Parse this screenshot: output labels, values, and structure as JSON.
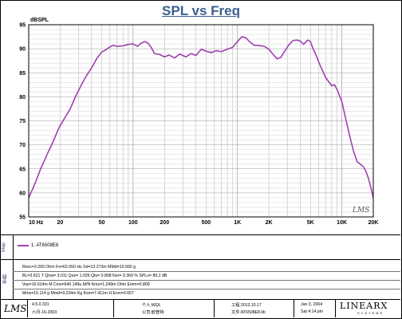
{
  "chart_data": {
    "type": "line",
    "title": "SPL vs Freq",
    "ylabel": "dBSPL",
    "xlabel": "",
    "x_scale": "log",
    "xlim": [
      10,
      20000
    ],
    "ylim": [
      55,
      95
    ],
    "grid": true,
    "y_ticks": [
      55,
      60,
      65,
      70,
      75,
      80,
      85,
      90,
      95
    ],
    "x_ticks": [
      {
        "value": 10,
        "label": "10 Hz"
      },
      {
        "value": 20,
        "label": "20"
      },
      {
        "value": 50,
        "label": "50"
      },
      {
        "value": 100,
        "label": "100"
      },
      {
        "value": 200,
        "label": "200"
      },
      {
        "value": 500,
        "label": "500"
      },
      {
        "value": 1000,
        "label": "1K"
      },
      {
        "value": 2000,
        "label": "2K"
      },
      {
        "value": 5000,
        "label": "5K"
      },
      {
        "value": 10000,
        "label": "10K"
      },
      {
        "value": 20000,
        "label": "20K"
      }
    ],
    "watermark": "LMS",
    "series": [
      {
        "name": "1: AT6508E8",
        "color": "#a040b0",
        "points": [
          [
            10,
            59
          ],
          [
            11,
            61
          ],
          [
            12,
            63
          ],
          [
            13,
            65
          ],
          [
            14,
            66.5
          ],
          [
            15,
            68
          ],
          [
            17,
            70.5
          ],
          [
            19,
            73
          ],
          [
            20,
            74
          ],
          [
            22,
            75.5
          ],
          [
            25,
            77.5
          ],
          [
            28,
            80
          ],
          [
            32,
            82.5
          ],
          [
            36,
            84.5
          ],
          [
            40,
            86
          ],
          [
            45,
            88
          ],
          [
            50,
            89.3
          ],
          [
            55,
            89.8
          ],
          [
            60,
            90.4
          ],
          [
            65,
            90.7
          ],
          [
            70,
            90.5
          ],
          [
            80,
            90.6
          ],
          [
            90,
            90.9
          ],
          [
            100,
            91
          ],
          [
            110,
            90.5
          ],
          [
            120,
            91.2
          ],
          [
            130,
            91.5
          ],
          [
            140,
            91.1
          ],
          [
            150,
            90.2
          ],
          [
            160,
            89
          ],
          [
            180,
            88.8
          ],
          [
            200,
            88.3
          ],
          [
            220,
            88.7
          ],
          [
            250,
            88.1
          ],
          [
            280,
            88.9
          ],
          [
            320,
            88.3
          ],
          [
            360,
            89
          ],
          [
            400,
            88.6
          ],
          [
            450,
            89.9
          ],
          [
            500,
            89.5
          ],
          [
            560,
            89.2
          ],
          [
            630,
            89.6
          ],
          [
            700,
            89.4
          ],
          [
            800,
            89.9
          ],
          [
            900,
            90.3
          ],
          [
            1000,
            91.5
          ],
          [
            1100,
            92.5
          ],
          [
            1200,
            92.3
          ],
          [
            1300,
            91.5
          ],
          [
            1450,
            90.7
          ],
          [
            1600,
            90.7
          ],
          [
            1800,
            90.5
          ],
          [
            2000,
            89.9
          ],
          [
            2200,
            88.8
          ],
          [
            2400,
            87.9
          ],
          [
            2600,
            88.2
          ],
          [
            2800,
            89.3
          ],
          [
            3100,
            90.8
          ],
          [
            3400,
            91.7
          ],
          [
            3700,
            91.8
          ],
          [
            4000,
            91.6
          ],
          [
            4300,
            90.9
          ],
          [
            4700,
            91.8
          ],
          [
            5000,
            91.5
          ],
          [
            5300,
            90
          ],
          [
            5700,
            88.5
          ],
          [
            6200,
            86.5
          ],
          [
            7000,
            84
          ],
          [
            8000,
            82.3
          ],
          [
            8500,
            82.5
          ],
          [
            9000,
            81.5
          ],
          [
            10000,
            79
          ],
          [
            11000,
            75
          ],
          [
            12000,
            71.5
          ],
          [
            13000,
            68.5
          ],
          [
            14000,
            66.5
          ],
          [
            15000,
            66
          ],
          [
            16000,
            65.5
          ],
          [
            17000,
            64.5
          ],
          [
            18000,
            63
          ],
          [
            19000,
            61
          ],
          [
            20000,
            59
          ]
        ]
      }
    ]
  },
  "legend_band": {
    "side_label": "Map",
    "entry": "1: AT6508E8"
  },
  "params": {
    "side_label": "参数",
    "lines": [
      "Revc=3.200 Ohm  Fo=62.650 Hz  Sd=13.273m MMd=10.000 g",
      "BL=3.621 T  Qms= 3.011  Qes= 1.026  Qts= 0.808  Nor= 0.369 %  SPLo= 89.2 dB",
      "Vas=16.014m M Cms=640.149u M/N  Kms=1.249m Ohm  Emm=0.809",
      "Mms=16.114 g  Mmd=9.234m Kg  Kxm=7.411m H  Exm=0.657"
    ]
  },
  "footer": {
    "logo": "LMS",
    "version": "4.5.0.331",
    "version_date": "六月-16-2003",
    "person_label": "个人:WQL",
    "company_label": "公司:欧普特",
    "project_label": "工程:2013.10.17",
    "file_label": "文件:AT6508E8.lib",
    "date": "Jan  3, 2004",
    "time": "Sat  4:14 pm",
    "brand": "LINEARX",
    "brand_sub": "SYSTEMS"
  }
}
